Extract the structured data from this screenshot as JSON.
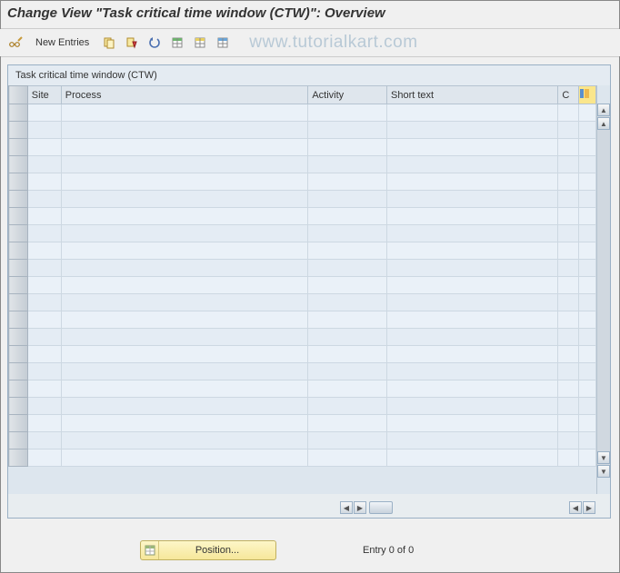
{
  "title": "Change View \"Task critical time window (CTW)\": Overview",
  "toolbar": {
    "new_entries_label": "New Entries"
  },
  "watermark": "www.tutorialkart.com",
  "panel": {
    "title": "Task critical time window (CTW)"
  },
  "columns": {
    "site": "Site",
    "process": "Process",
    "activity": "Activity",
    "shorttext": "Short text",
    "c": "C"
  },
  "footer": {
    "position_label": "Position...",
    "entry_text": "Entry 0 of 0"
  }
}
